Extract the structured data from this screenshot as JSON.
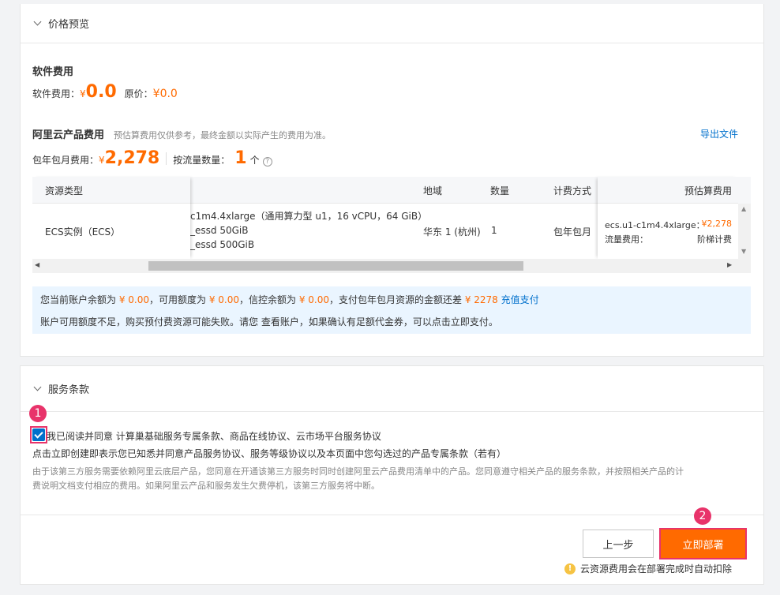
{
  "price_preview": {
    "header": "价格预览",
    "software_title": "软件费用",
    "software_fee_label": "软件费用：",
    "software_fee_currency": "¥",
    "software_fee_value": "0.0",
    "original_price_label": "原价：",
    "original_price_value": "¥0.0",
    "cloud_title": "阿里云产品费用",
    "cloud_note": "预估算费用仅供参考，最终金额以实际产生的费用为准。",
    "export_link": "导出文件",
    "subscription_label": "包年包月费用：",
    "subscription_currency": "¥",
    "subscription_value": "2,278",
    "traffic_label": "按流量数量：",
    "traffic_count": "1",
    "traffic_unit": "个",
    "table": {
      "headers": [
        "资源类型",
        "地域",
        "数量",
        "计费方式",
        "预估算费用"
      ],
      "row": {
        "type": "ECS实例（ECS）",
        "spec_lines": [
          "c1m4.4xlarge（通用算力型 u1，16 vCPU，64 GiB）",
          "_essd 50GiB",
          "_essd 500GiB"
        ],
        "region": "华东 1 (杭州)",
        "qty": "1",
        "billing": "包年包月",
        "est_line1_label": "ecs.u1-c1m4.4xlarge：",
        "est_line1_value": "¥2,278",
        "est_line2_label": "流量费用：",
        "est_line2_value": "阶梯计费"
      }
    },
    "notice": {
      "t1": "您当前账户余额为 ",
      "v1": "¥ 0.00",
      "t2": "，可用额度为 ",
      "v2": "¥ 0.00",
      "t3": "，信控余额为 ",
      "v3": "¥ 0.00",
      "t4": "，支付包年包月资源的金额还差 ",
      "v4": "¥ 2278",
      "link": " 充值支付",
      "line2": "账户可用额度不足，购买预付费资源可能失败。请您 查看账户，如果确认有足额代金券，可以点击立即支付。"
    }
  },
  "terms": {
    "header": "服务条款",
    "agree_text": "我已阅读并同意 计算巢基础服务专属条款、商品在线协议、云市场平台服务协议",
    "statement": "点击立即创建即表示您已知悉并同意产品服务协议、服务等级协议以及本页面中您勾选过的产品专属条款（若有）",
    "desc_line1": "由于该第三方服务需要依赖阿里云底层产品，您同意在开通该第三方服务时同时创建阿里云产品费用清单中的产品。您同意遵守相关产品的服务条款，并按照相关产品的计",
    "desc_line2": "费说明文档支付相应的费用。如果阿里云产品和服务发生欠费停机，该第三方服务将中断。"
  },
  "footer": {
    "prev_button": "上一步",
    "deploy_button": "立即部署",
    "hint": "云资源费用会在部署完成时自动扣除"
  },
  "annotations": {
    "badge1": "1",
    "badge2": "2"
  }
}
